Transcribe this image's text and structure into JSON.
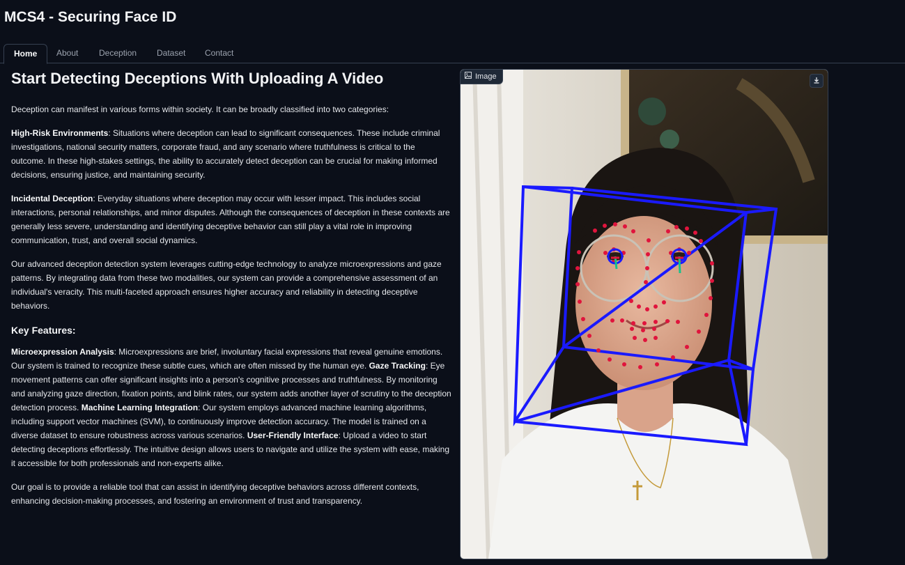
{
  "app": {
    "title": "MCS4 - Securing Face ID"
  },
  "tabs": [
    {
      "label": "Home",
      "active": true
    },
    {
      "label": "About",
      "active": false
    },
    {
      "label": "Deception",
      "active": false
    },
    {
      "label": "Dataset",
      "active": false
    },
    {
      "label": "Contact",
      "active": false
    }
  ],
  "main": {
    "heading": "Start Detecting Deceptions With Uploading A Video",
    "intro": "Deception can manifest in various forms within society. It can be broadly classified into two categories:",
    "high_risk": {
      "term": "High-Risk Environments",
      "text": ": Situations where deception can lead to significant consequences. These include criminal investigations, national security matters, corporate fraud, and any scenario where truthfulness is critical to the outcome. In these high-stakes settings, the ability to accurately detect deception can be crucial for making informed decisions, ensuring justice, and maintaining security."
    },
    "incidental": {
      "term": "Incidental Deception",
      "text": ": Everyday situations where deception may occur with lesser impact. This includes social interactions, personal relationships, and minor disputes. Although the consequences of deception in these contexts are generally less severe, understanding and identifying deceptive behavior can still play a vital role in improving communication, trust, and overall social dynamics."
    },
    "system": "Our advanced deception detection system leverages cutting-edge technology to analyze microexpressions and gaze patterns. By integrating data from these two modalities, our system can provide a comprehensive assessment of an individual's veracity. This multi-faceted approach ensures higher accuracy and reliability in detecting deceptive behaviors.",
    "key_features_heading": "Key Features:",
    "features": {
      "micro_term": "Microexpression Analysis",
      "micro_text": ": Microexpressions are brief, involuntary facial expressions that reveal genuine emotions. Our system is trained to recognize these subtle cues, which are often missed by the human eye. ",
      "gaze_term": "Gaze Tracking",
      "gaze_text": ": Eye movement patterns can offer significant insights into a person's cognitive processes and truthfulness. By monitoring and analyzing gaze direction, fixation points, and blink rates, our system adds another layer of scrutiny to the deception detection process. ",
      "ml_term": "Machine Learning Integration",
      "ml_text": ": Our system employs advanced machine learning algorithms, including support vector machines (SVM), to continuously improve detection accuracy. The model is trained on a diverse dataset to ensure robustness across various scenarios. ",
      "ui_term": "User-Friendly Interface",
      "ui_text": ": Upload a video to start detecting deceptions effortlessly. The intuitive design allows users to navigate and utilize the system with ease, making it accessible for both professionals and non-experts alike."
    },
    "goal": "Our goal is to provide a reliable tool that can assist in identifying deceptive behaviors across different contexts, enhancing decision-making processes, and fostering an environment of trust and transparency."
  },
  "image_panel": {
    "label": "Image",
    "label_icon": "image-icon",
    "download_icon": "download-icon"
  },
  "colors": {
    "background": "#0b0f19",
    "landmark": "#e0143c",
    "head_box": "#1a1aff",
    "gaze_arrow": "#17c28a"
  }
}
